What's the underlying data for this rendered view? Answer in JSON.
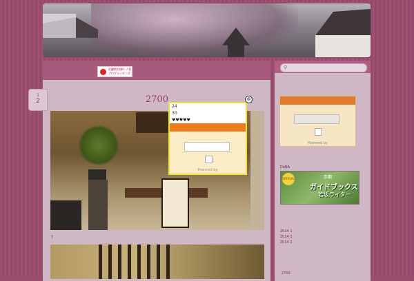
{
  "date": {
    "month": "1",
    "day": "2"
  },
  "post": {
    "title": "2700",
    "caption": "↑"
  },
  "popup": {
    "line1": "24",
    "line2": "30",
    "line3": "♥♥♥♥♥",
    "powered": "Powered by",
    "close": "⊗"
  },
  "banner": {
    "text": "近畿地方旅行 人気ブログランキング"
  },
  "sidebar": {
    "search_placeholder": "",
    "widget_powered": "Powered by",
    "guide_heading": "DeNA",
    "guide_seal": "OFFICIAL",
    "guide_kanji": "京都",
    "guide_title": "ガイドブックス",
    "guide_sub": "若坂ライター",
    "archives": [
      "2014 1",
      "2014 1",
      "2014 1"
    ],
    "footer": "2700"
  },
  "colors": {
    "accent": "#9a3a66",
    "orange": "#ef7d1c",
    "popup_border": "#e8e23a"
  }
}
